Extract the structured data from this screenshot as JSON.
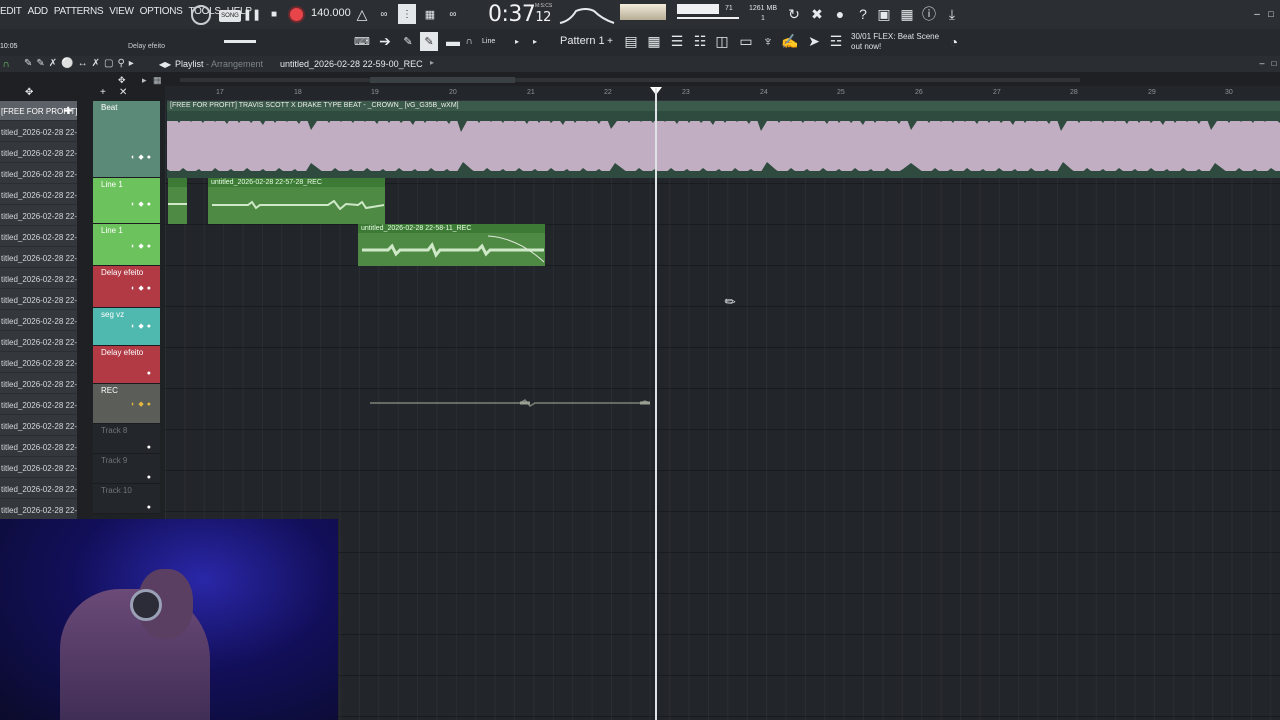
{
  "menu": [
    "EDIT",
    "ADD",
    "PATTERNS",
    "VIEW",
    "OPTIONS",
    "TOOLS",
    "HELP"
  ],
  "transport": {
    "song_label": "SONG",
    "tempo": "140.000",
    "clock_main": "0:37",
    "clock_sub": "12",
    "clock_unit": "M:S:CS"
  },
  "monitor": {
    "cpu_value": "71",
    "memory": "1261 MB",
    "voices": "1"
  },
  "hint": {
    "line1": "30/01  FLEX: Beat Scene",
    "line2": "out now!"
  },
  "toolbar2": {
    "snap": "Line",
    "pattern": "Pattern 1"
  },
  "left_info": {
    "time": "10:05",
    "selected": "Delay efeito"
  },
  "playlist": {
    "title": "Playlist",
    "subtitle": "Arrangement",
    "file": "untitled_2026-02-28 22-59-00_REC"
  },
  "ruler": [
    "17",
    "18",
    "19",
    "20",
    "21",
    "22",
    "23",
    "24",
    "25",
    "26",
    "27",
    "28",
    "29",
    "30"
  ],
  "browser": [
    "[FREE FOR PROFIT] T...",
    "titled_2026-02-28 22-",
    "titled_2026-02-28 22-",
    "titled_2026-02-28 22-",
    "titled_2026-02-28 22-",
    "titled_2026-02-28 22-",
    "titled_2026-02-28 22-",
    "titled_2026-02-28 22-",
    "titled_2026-02-28 22-",
    "titled_2026-02-28 22-",
    "titled_2026-02-28 22-",
    "titled_2026-02-28 22-",
    "titled_2026-02-28 22-",
    "titled_2026-02-28 22-",
    "titled_2026-02-28 22-",
    "titled_2026-02-28 22-",
    "titled_2026-02-28 22-",
    "titled_2026-02-28 22-",
    "titled_2026-02-28 22-",
    "titled_2026-02-28 22-"
  ],
  "tracks": [
    {
      "name": "Beat",
      "color": "#5c8a78"
    },
    {
      "name": "Line 1",
      "color": "#6cc25c"
    },
    {
      "name": "Line 1",
      "color": "#6cc25c"
    },
    {
      "name": "Delay efeito",
      "color": "#b13a45"
    },
    {
      "name": "seg vz",
      "color": "#4fb9b0"
    },
    {
      "name": "Delay efeito",
      "color": "#b13a45"
    },
    {
      "name": "REC",
      "color": "#5a5d58"
    },
    {
      "name": "Track 8",
      "color": "#23262a"
    },
    {
      "name": "Track 9",
      "color": "#23262a"
    },
    {
      "name": "Track 10",
      "color": "#23262a"
    }
  ],
  "clips": {
    "beat": "[FREE FOR PROFIT] TRAVIS SCOTT X DRAKE TYPE BEAT - _CROWN_ [vG_G35B_wXM]",
    "line1": "untitled_2026-02-28 22-57-28_REC",
    "line2": "untitled_2026-02-28 22-58-11_REC"
  }
}
